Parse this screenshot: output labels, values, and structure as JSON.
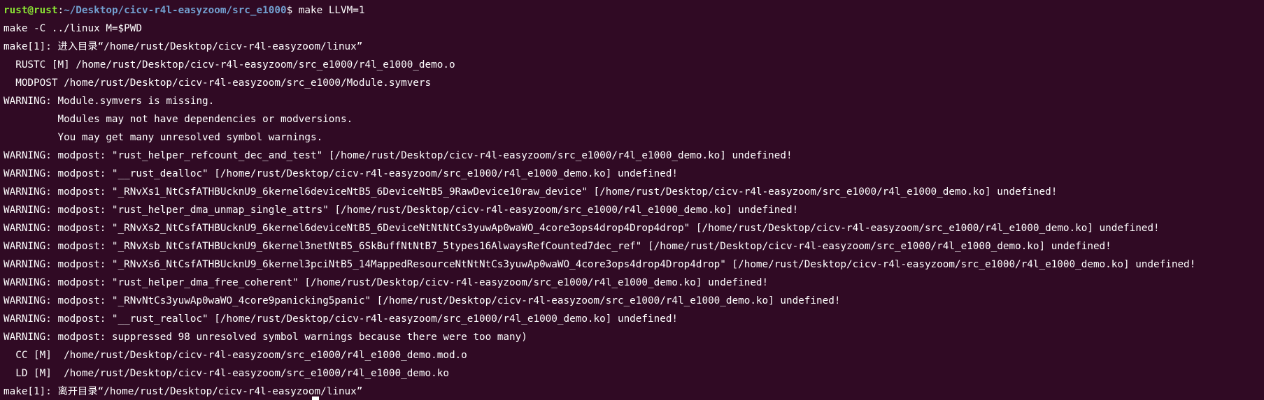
{
  "terminal": {
    "prompt": {
      "user_host": "rust@rust",
      "separator": ":",
      "path": "~/Desktop/cicv-r4l-easyzoom/src_e1000",
      "symbol": "$ ",
      "command": "make LLVM=1"
    },
    "lines": [
      "make -C ../linux M=$PWD",
      "make[1]: 进入目录“/home/rust/Desktop/cicv-r4l-easyzoom/linux”",
      "  RUSTC [M] /home/rust/Desktop/cicv-r4l-easyzoom/src_e1000/r4l_e1000_demo.o",
      "  MODPOST /home/rust/Desktop/cicv-r4l-easyzoom/src_e1000/Module.symvers",
      "WARNING: Module.symvers is missing.",
      "         Modules may not have dependencies or modversions.",
      "         You may get many unresolved symbol warnings.",
      "WARNING: modpost: \"rust_helper_refcount_dec_and_test\" [/home/rust/Desktop/cicv-r4l-easyzoom/src_e1000/r4l_e1000_demo.ko] undefined!",
      "WARNING: modpost: \"__rust_dealloc\" [/home/rust/Desktop/cicv-r4l-easyzoom/src_e1000/r4l_e1000_demo.ko] undefined!",
      "WARNING: modpost: \"_RNvXs1_NtCsfATHBUcknU9_6kernel6deviceNtB5_6DeviceNtB5_9RawDevice10raw_device\" [/home/rust/Desktop/cicv-r4l-easyzoom/src_e1000/r4l_e1000_demo.ko] undefined!",
      "WARNING: modpost: \"rust_helper_dma_unmap_single_attrs\" [/home/rust/Desktop/cicv-r4l-easyzoom/src_e1000/r4l_e1000_demo.ko] undefined!",
      "WARNING: modpost: \"_RNvXs2_NtCsfATHBUcknU9_6kernel6deviceNtB5_6DeviceNtNtNtCs3yuwAp0waWO_4core3ops4drop4Drop4drop\" [/home/rust/Desktop/cicv-r4l-easyzoom/src_e1000/r4l_e1000_demo.ko] undefined!",
      "WARNING: modpost: \"_RNvXsb_NtCsfATHBUcknU9_6kernel3netNtB5_6SkBuffNtNtB7_5types16AlwaysRefCounted7dec_ref\" [/home/rust/Desktop/cicv-r4l-easyzoom/src_e1000/r4l_e1000_demo.ko] undefined!",
      "WARNING: modpost: \"_RNvXs6_NtCsfATHBUcknU9_6kernel3pciNtB5_14MappedResourceNtNtNtCs3yuwAp0waWO_4core3ops4drop4Drop4drop\" [/home/rust/Desktop/cicv-r4l-easyzoom/src_e1000/r4l_e1000_demo.ko] undefined!",
      "WARNING: modpost: \"rust_helper_dma_free_coherent\" [/home/rust/Desktop/cicv-r4l-easyzoom/src_e1000/r4l_e1000_demo.ko] undefined!",
      "WARNING: modpost: \"_RNvNtCs3yuwAp0waWO_4core9panicking5panic\" [/home/rust/Desktop/cicv-r4l-easyzoom/src_e1000/r4l_e1000_demo.ko] undefined!",
      "WARNING: modpost: \"__rust_realloc\" [/home/rust/Desktop/cicv-r4l-easyzoom/src_e1000/r4l_e1000_demo.ko] undefined!",
      "WARNING: modpost: suppressed 98 unresolved symbol warnings because there were too many)",
      "  CC [M]  /home/rust/Desktop/cicv-r4l-easyzoom/src_e1000/r4l_e1000_demo.mod.o",
      "  LD [M]  /home/rust/Desktop/cicv-r4l-easyzoom/src_e1000/r4l_e1000_demo.ko",
      "make[1]: 离开目录“/home/rust/Desktop/cicv-r4l-easyzoom/linux”"
    ],
    "colors": {
      "background": "#300a24",
      "text": "#ffffff",
      "prompt_user": "#8ae234",
      "prompt_path": "#729fcf"
    }
  }
}
